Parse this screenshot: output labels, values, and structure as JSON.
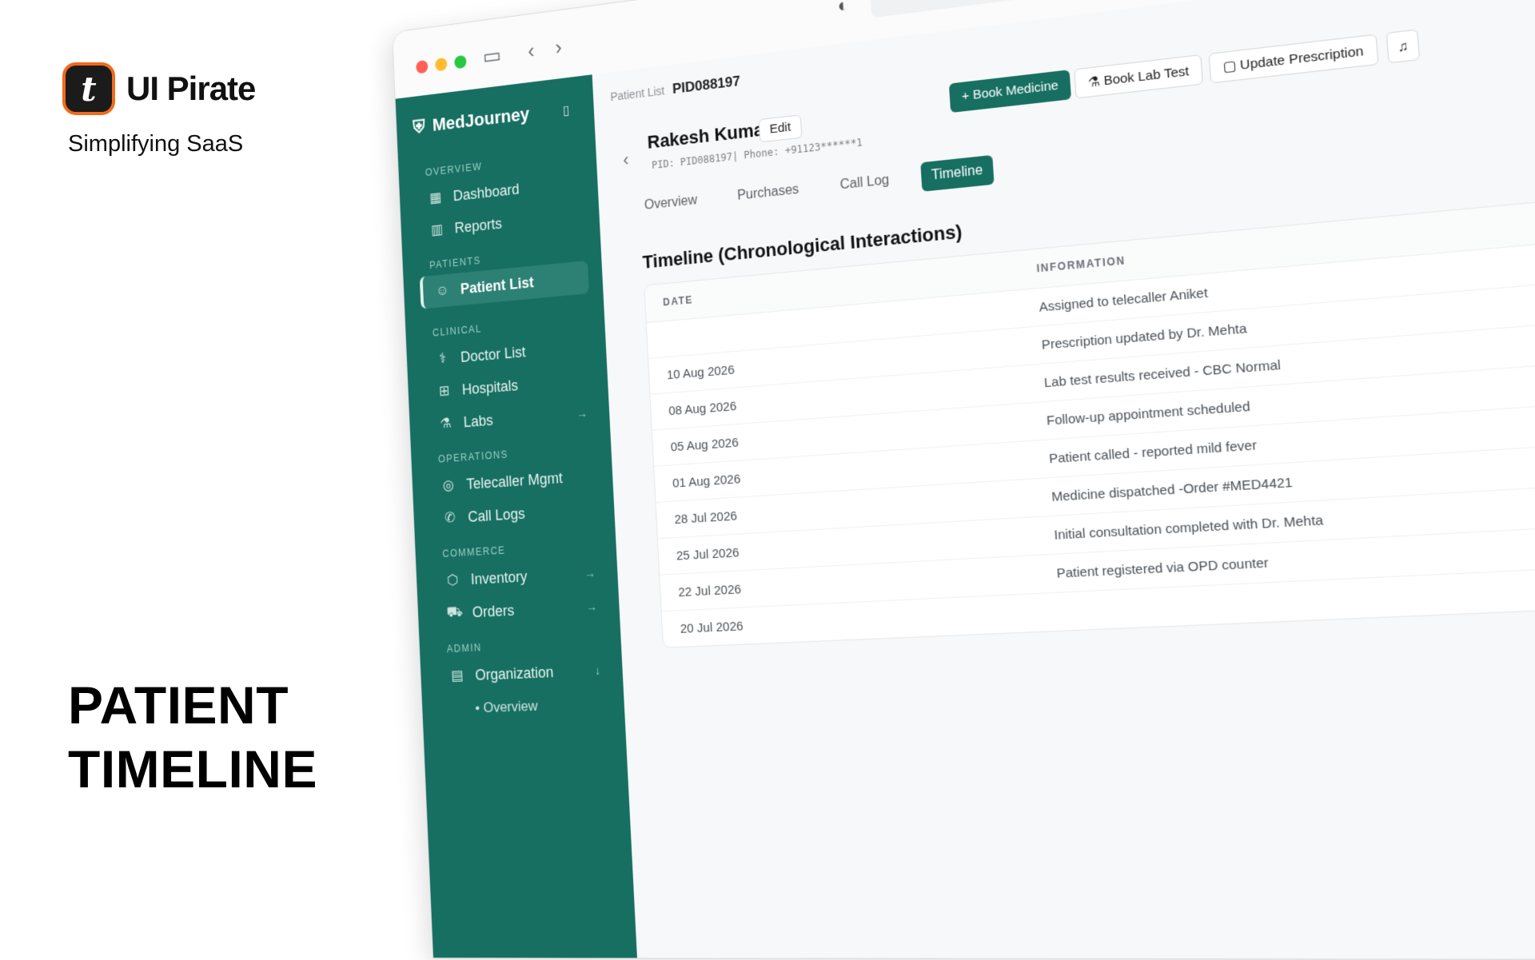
{
  "brand": {
    "logo_letter": "t",
    "name": "UI Pirate",
    "tagline": "Simplifying SaaS"
  },
  "hero": {
    "line1": "PATIENT",
    "line2": "TIMELINE"
  },
  "sidebar": {
    "app_name": "MedJourney",
    "sections": {
      "overview": "OVERVIEW",
      "patients": "PATIENTS",
      "clinical": "CLINICAL",
      "operations": "OPERATIONS",
      "commerce": "COMMERCE",
      "admin": "ADMIN"
    },
    "items": {
      "dashboard": "Dashboard",
      "reports": "Reports",
      "patient_list": "Patient List",
      "doctor_list": "Doctor List",
      "hospitals": "Hospitals",
      "labs": "Labs",
      "telecaller": "Telecaller Mgmt",
      "call_logs": "Call Logs",
      "inventory": "Inventory",
      "orders": "Orders",
      "organization": "Organization",
      "org_overview": "Overview"
    }
  },
  "breadcrumb": {
    "parent": "Patient List",
    "current": "PID088197"
  },
  "patient": {
    "name": "Rakesh Kumar",
    "edit_label": "Edit",
    "meta": "PID: PID088197| Phone: +91123******1"
  },
  "actions": {
    "book_medicine": "+ Book Medicine",
    "book_lab": "Book Lab Test",
    "update_rx": "Update Prescription"
  },
  "tabs": [
    "Overview",
    "Purchases",
    "Call Log",
    "Timeline"
  ],
  "timeline": {
    "title": "Timeline (Chronological Interactions)",
    "col_date": "DATE",
    "col_info": "INFORMATION",
    "rows": [
      {
        "date": "",
        "info": "Assigned to telecaller Aniket"
      },
      {
        "date": "10 Aug 2026",
        "info": "Prescription updated by Dr. Mehta"
      },
      {
        "date": "08 Aug 2026",
        "info": "Lab test results received - CBC Normal"
      },
      {
        "date": "05 Aug 2026",
        "info": "Follow-up appointment scheduled"
      },
      {
        "date": "01 Aug 2026",
        "info": "Patient called - reported mild fever"
      },
      {
        "date": "28 Jul 2026",
        "info": "Medicine dispatched -Order #MED4421"
      },
      {
        "date": "25 Jul 2026",
        "info": "Initial consultation completed with Dr. Mehta"
      },
      {
        "date": "22 Jul 2026",
        "info": "Patient registered via OPD counter"
      },
      {
        "date": "20 Jul 2026",
        "info": ""
      }
    ]
  }
}
